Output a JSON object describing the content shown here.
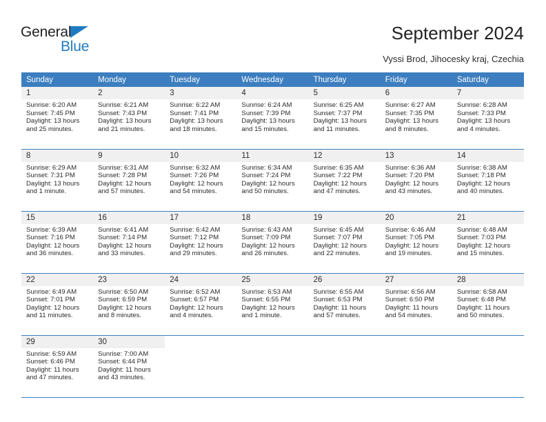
{
  "brand": {
    "name_top": "General",
    "name_bottom": "Blue",
    "triangle_color": "#1f7bc1",
    "text_color": "#231f20"
  },
  "header": {
    "title": "September 2024",
    "subtitle": "Vyssi Brod, Jihocesky kraj, Czechia"
  },
  "theme": {
    "header_bg": "#3c7ebf",
    "header_text": "#ffffff",
    "daynum_bg": "#f0f0f0",
    "row_border": "#3c7ebf"
  },
  "calendar": {
    "weekday_headers": [
      "Sunday",
      "Monday",
      "Tuesday",
      "Wednesday",
      "Thursday",
      "Friday",
      "Saturday"
    ],
    "weeks": [
      [
        {
          "day": "1",
          "sunrise": "Sunrise: 6:20 AM",
          "sunset": "Sunset: 7:45 PM",
          "daylight1": "Daylight: 13 hours",
          "daylight2": "and 25 minutes."
        },
        {
          "day": "2",
          "sunrise": "Sunrise: 6:21 AM",
          "sunset": "Sunset: 7:43 PM",
          "daylight1": "Daylight: 13 hours",
          "daylight2": "and 21 minutes."
        },
        {
          "day": "3",
          "sunrise": "Sunrise: 6:22 AM",
          "sunset": "Sunset: 7:41 PM",
          "daylight1": "Daylight: 13 hours",
          "daylight2": "and 18 minutes."
        },
        {
          "day": "4",
          "sunrise": "Sunrise: 6:24 AM",
          "sunset": "Sunset: 7:39 PM",
          "daylight1": "Daylight: 13 hours",
          "daylight2": "and 15 minutes."
        },
        {
          "day": "5",
          "sunrise": "Sunrise: 6:25 AM",
          "sunset": "Sunset: 7:37 PM",
          "daylight1": "Daylight: 13 hours",
          "daylight2": "and 11 minutes."
        },
        {
          "day": "6",
          "sunrise": "Sunrise: 6:27 AM",
          "sunset": "Sunset: 7:35 PM",
          "daylight1": "Daylight: 13 hours",
          "daylight2": "and 8 minutes."
        },
        {
          "day": "7",
          "sunrise": "Sunrise: 6:28 AM",
          "sunset": "Sunset: 7:33 PM",
          "daylight1": "Daylight: 13 hours",
          "daylight2": "and 4 minutes."
        }
      ],
      [
        {
          "day": "8",
          "sunrise": "Sunrise: 6:29 AM",
          "sunset": "Sunset: 7:31 PM",
          "daylight1": "Daylight: 13 hours",
          "daylight2": "and 1 minute."
        },
        {
          "day": "9",
          "sunrise": "Sunrise: 6:31 AM",
          "sunset": "Sunset: 7:28 PM",
          "daylight1": "Daylight: 12 hours",
          "daylight2": "and 57 minutes."
        },
        {
          "day": "10",
          "sunrise": "Sunrise: 6:32 AM",
          "sunset": "Sunset: 7:26 PM",
          "daylight1": "Daylight: 12 hours",
          "daylight2": "and 54 minutes."
        },
        {
          "day": "11",
          "sunrise": "Sunrise: 6:34 AM",
          "sunset": "Sunset: 7:24 PM",
          "daylight1": "Daylight: 12 hours",
          "daylight2": "and 50 minutes."
        },
        {
          "day": "12",
          "sunrise": "Sunrise: 6:35 AM",
          "sunset": "Sunset: 7:22 PM",
          "daylight1": "Daylight: 12 hours",
          "daylight2": "and 47 minutes."
        },
        {
          "day": "13",
          "sunrise": "Sunrise: 6:36 AM",
          "sunset": "Sunset: 7:20 PM",
          "daylight1": "Daylight: 12 hours",
          "daylight2": "and 43 minutes."
        },
        {
          "day": "14",
          "sunrise": "Sunrise: 6:38 AM",
          "sunset": "Sunset: 7:18 PM",
          "daylight1": "Daylight: 12 hours",
          "daylight2": "and 40 minutes."
        }
      ],
      [
        {
          "day": "15",
          "sunrise": "Sunrise: 6:39 AM",
          "sunset": "Sunset: 7:16 PM",
          "daylight1": "Daylight: 12 hours",
          "daylight2": "and 36 minutes."
        },
        {
          "day": "16",
          "sunrise": "Sunrise: 6:41 AM",
          "sunset": "Sunset: 7:14 PM",
          "daylight1": "Daylight: 12 hours",
          "daylight2": "and 33 minutes."
        },
        {
          "day": "17",
          "sunrise": "Sunrise: 6:42 AM",
          "sunset": "Sunset: 7:12 PM",
          "daylight1": "Daylight: 12 hours",
          "daylight2": "and 29 minutes."
        },
        {
          "day": "18",
          "sunrise": "Sunrise: 6:43 AM",
          "sunset": "Sunset: 7:09 PM",
          "daylight1": "Daylight: 12 hours",
          "daylight2": "and 26 minutes."
        },
        {
          "day": "19",
          "sunrise": "Sunrise: 6:45 AM",
          "sunset": "Sunset: 7:07 PM",
          "daylight1": "Daylight: 12 hours",
          "daylight2": "and 22 minutes."
        },
        {
          "day": "20",
          "sunrise": "Sunrise: 6:46 AM",
          "sunset": "Sunset: 7:05 PM",
          "daylight1": "Daylight: 12 hours",
          "daylight2": "and 19 minutes."
        },
        {
          "day": "21",
          "sunrise": "Sunrise: 6:48 AM",
          "sunset": "Sunset: 7:03 PM",
          "daylight1": "Daylight: 12 hours",
          "daylight2": "and 15 minutes."
        }
      ],
      [
        {
          "day": "22",
          "sunrise": "Sunrise: 6:49 AM",
          "sunset": "Sunset: 7:01 PM",
          "daylight1": "Daylight: 12 hours",
          "daylight2": "and 11 minutes."
        },
        {
          "day": "23",
          "sunrise": "Sunrise: 6:50 AM",
          "sunset": "Sunset: 6:59 PM",
          "daylight1": "Daylight: 12 hours",
          "daylight2": "and 8 minutes."
        },
        {
          "day": "24",
          "sunrise": "Sunrise: 6:52 AM",
          "sunset": "Sunset: 6:57 PM",
          "daylight1": "Daylight: 12 hours",
          "daylight2": "and 4 minutes."
        },
        {
          "day": "25",
          "sunrise": "Sunrise: 6:53 AM",
          "sunset": "Sunset: 6:55 PM",
          "daylight1": "Daylight: 12 hours",
          "daylight2": "and 1 minute."
        },
        {
          "day": "26",
          "sunrise": "Sunrise: 6:55 AM",
          "sunset": "Sunset: 6:53 PM",
          "daylight1": "Daylight: 11 hours",
          "daylight2": "and 57 minutes."
        },
        {
          "day": "27",
          "sunrise": "Sunrise: 6:56 AM",
          "sunset": "Sunset: 6:50 PM",
          "daylight1": "Daylight: 11 hours",
          "daylight2": "and 54 minutes."
        },
        {
          "day": "28",
          "sunrise": "Sunrise: 6:58 AM",
          "sunset": "Sunset: 6:48 PM",
          "daylight1": "Daylight: 11 hours",
          "daylight2": "and 50 minutes."
        }
      ],
      [
        {
          "day": "29",
          "sunrise": "Sunrise: 6:59 AM",
          "sunset": "Sunset: 6:46 PM",
          "daylight1": "Daylight: 11 hours",
          "daylight2": "and 47 minutes."
        },
        {
          "day": "30",
          "sunrise": "Sunrise: 7:00 AM",
          "sunset": "Sunset: 6:44 PM",
          "daylight1": "Daylight: 11 hours",
          "daylight2": "and 43 minutes."
        },
        {
          "day": "",
          "sunrise": "",
          "sunset": "",
          "daylight1": "",
          "daylight2": ""
        },
        {
          "day": "",
          "sunrise": "",
          "sunset": "",
          "daylight1": "",
          "daylight2": ""
        },
        {
          "day": "",
          "sunrise": "",
          "sunset": "",
          "daylight1": "",
          "daylight2": ""
        },
        {
          "day": "",
          "sunrise": "",
          "sunset": "",
          "daylight1": "",
          "daylight2": ""
        },
        {
          "day": "",
          "sunrise": "",
          "sunset": "",
          "daylight1": "",
          "daylight2": ""
        }
      ]
    ]
  }
}
